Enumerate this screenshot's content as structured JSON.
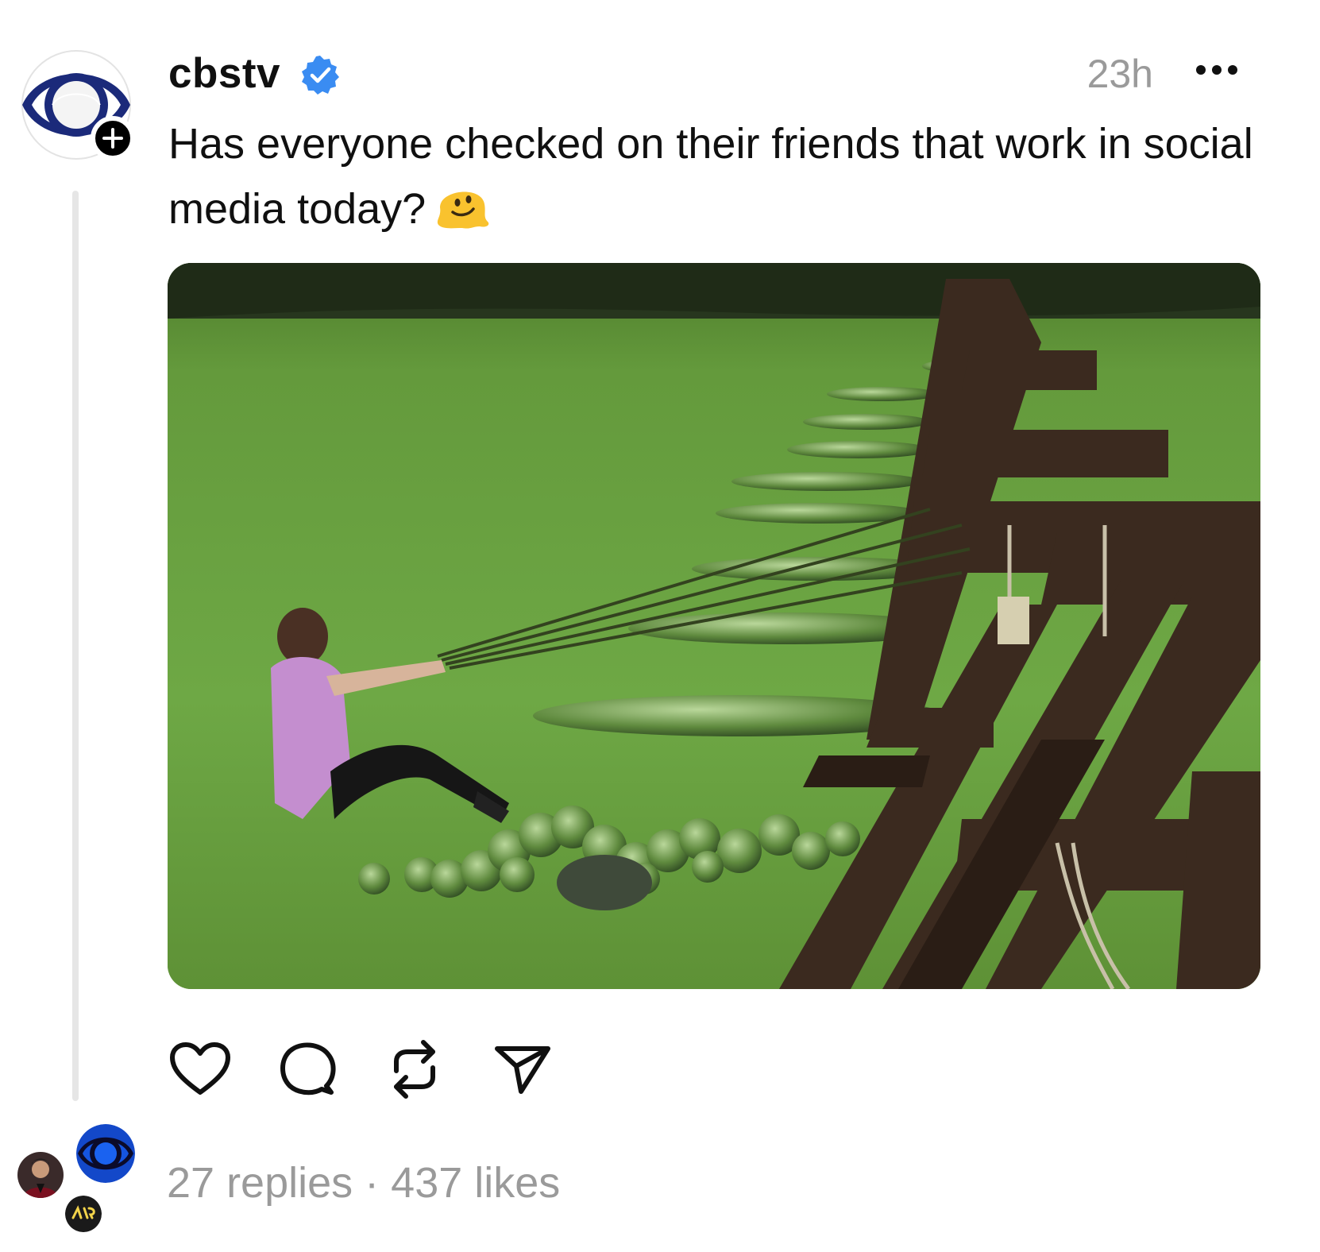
{
  "post": {
    "username": "cbstv",
    "verified": true,
    "timestamp": "23h",
    "caption": "Has everyone checked on their friends that work in social media today?",
    "caption_emoji": "melting-face-emoji",
    "media_description_icon": "video-thumbnail",
    "stats": {
      "replies": "27 replies",
      "separator": "·",
      "likes": "437 likes"
    }
  },
  "icons": {
    "more": "more-horizontal-icon",
    "like": "heart-icon",
    "reply": "comment-bubble-icon",
    "repost": "repost-icon",
    "share": "send-icon",
    "follow": "plus-icon",
    "verified": "verified-badge-icon"
  },
  "colors": {
    "verified_blue": "#3a8cf2",
    "muted_text": "#9a9a9a",
    "thread_line": "#e6e6e6",
    "cbs_blue": "#1b2a7a"
  }
}
